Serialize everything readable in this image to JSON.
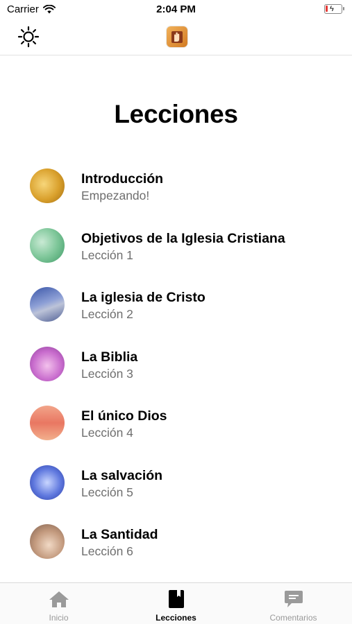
{
  "status_bar": {
    "carrier": "Carrier",
    "time": "2:04 PM",
    "battery_level": 0.15,
    "battery_color": "#e53935"
  },
  "nav": {
    "left_icon": "brightness-icon",
    "center_icon": "app-logo"
  },
  "page": {
    "title": "Lecciones"
  },
  "lessons": [
    {
      "title": "Introducción",
      "subtitle": "Empezando!",
      "thumb": "golden-light"
    },
    {
      "title": "Objetivos de la Iglesia Cristiana",
      "subtitle": "Lección 1",
      "thumb": "green-map"
    },
    {
      "title": "La iglesia de Cristo",
      "subtitle": "Lección 2",
      "thumb": "church-building"
    },
    {
      "title": "La Biblia",
      "subtitle": "Lección 3",
      "thumb": "pink-hands"
    },
    {
      "title": "El único Dios",
      "subtitle": "Lección 4",
      "thumb": "sunset-sky"
    },
    {
      "title": "La salvación",
      "subtitle": "Lección 5",
      "thumb": "blue-light"
    },
    {
      "title": "La Santidad",
      "subtitle": "Lección 6",
      "thumb": "open-hands"
    }
  ],
  "tabs": [
    {
      "label": "Inicio",
      "icon": "home-icon",
      "active": false
    },
    {
      "label": "Lecciones",
      "icon": "book-icon",
      "active": true
    },
    {
      "label": "Comentarios",
      "icon": "comment-icon",
      "active": false
    }
  ],
  "colors": {
    "subtitle": "#6e6e6e",
    "tab_inactive": "#999999",
    "tab_active": "#000000"
  }
}
